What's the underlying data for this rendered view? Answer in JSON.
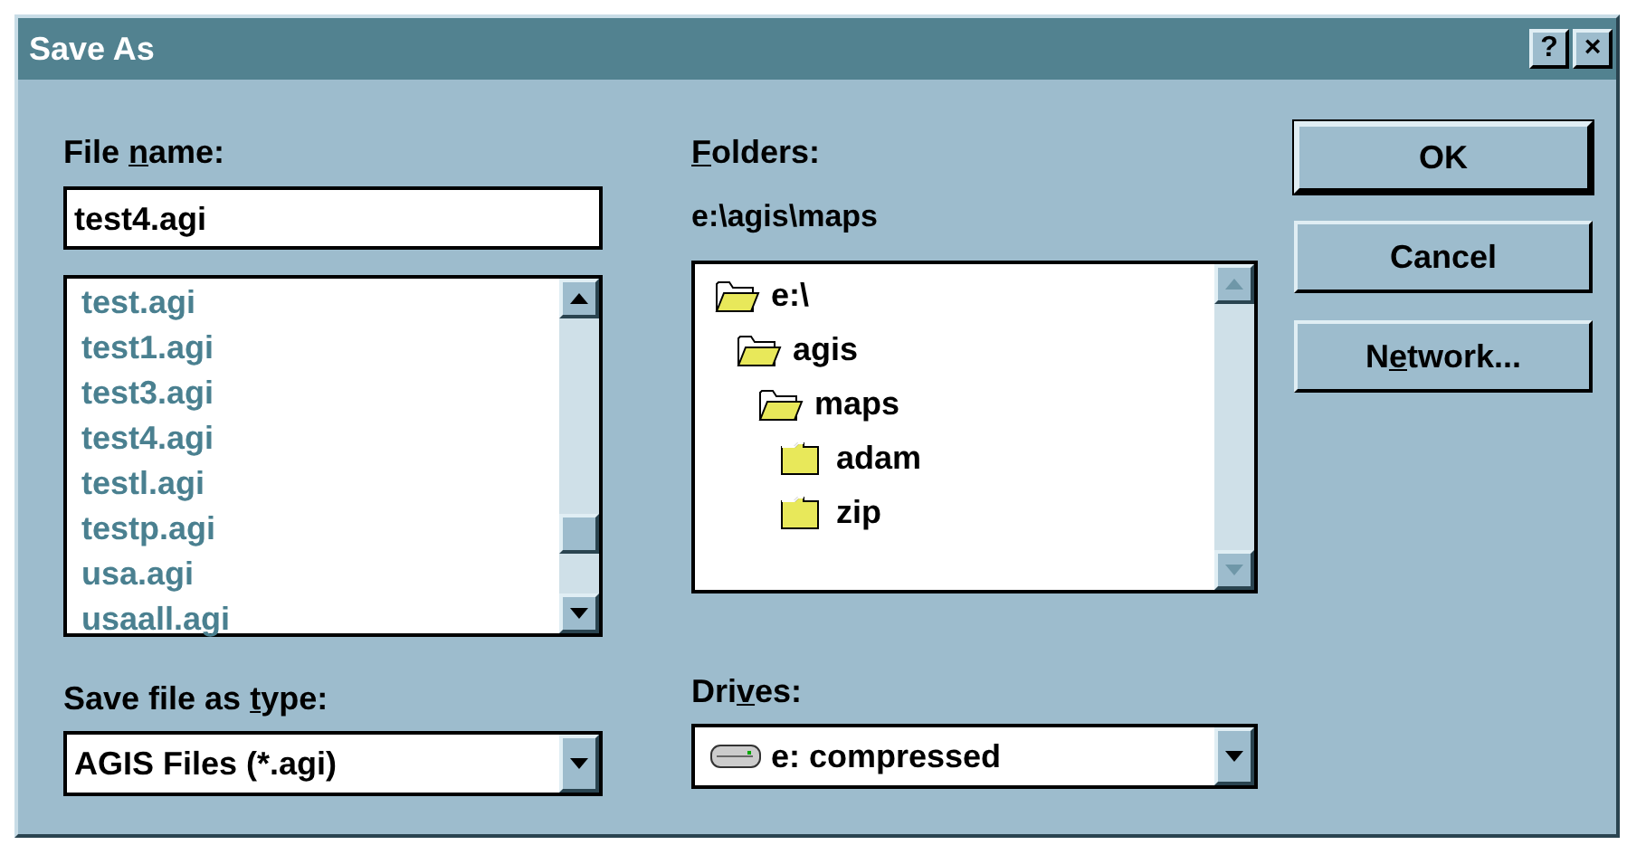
{
  "window": {
    "title": "Save As",
    "title_buttons": [
      "?",
      "×"
    ]
  },
  "file_name": {
    "label": {
      "before": "File ",
      "key": "n",
      "after": "ame:"
    },
    "value": "test4.agi"
  },
  "file_list": {
    "items": [
      "test.agi",
      "test1.agi",
      "test3.agi",
      "test4.agi",
      "testl.agi",
      "testp.agi",
      "usa.agi",
      "usaall.agi"
    ]
  },
  "save_type": {
    "label": {
      "before": "Save file as ",
      "key": "t",
      "after": "ype:"
    },
    "value": "AGIS Files (*.agi)"
  },
  "folders": {
    "label": {
      "key": "F",
      "after": "olders:"
    },
    "path": "e:\\agis\\maps",
    "tree": [
      {
        "name": "e:\\",
        "open": true,
        "children": [
          {
            "name": "agis",
            "open": true,
            "children": [
              {
                "name": "maps",
                "open": true,
                "children": [
                  {
                    "name": "adam",
                    "open": false
                  },
                  {
                    "name": "zip",
                    "open": false
                  }
                ]
              }
            ]
          }
        ]
      }
    ]
  },
  "drives": {
    "label": {
      "before": "Dri",
      "key": "v",
      "after": "es:"
    },
    "value": "e: compressed"
  },
  "buttons": [
    {
      "label": {
        "before": "OK"
      },
      "default": true
    },
    {
      "label": {
        "before": "Cancel"
      },
      "default": false
    },
    {
      "label": {
        "before": "N",
        "key": "e",
        "after": "twork..."
      },
      "default": false
    }
  ]
}
